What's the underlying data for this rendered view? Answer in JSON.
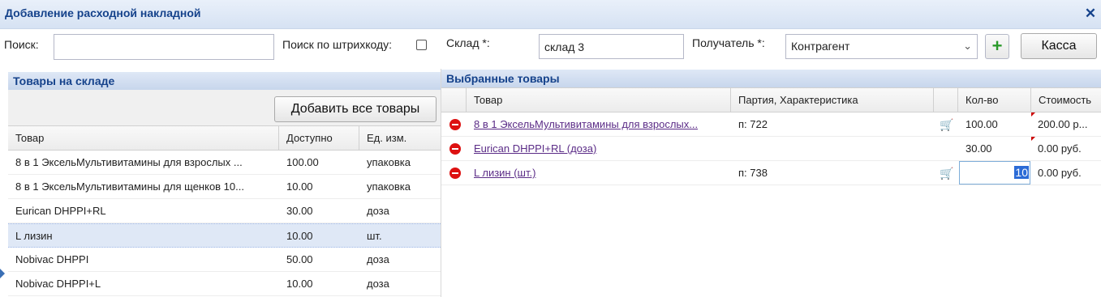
{
  "window": {
    "title": "Добавление расходной накладной"
  },
  "search": {
    "label": "Поиск:",
    "value": "",
    "barcode_label": "Поиск по штрихкоду:",
    "barcode_checked": false
  },
  "warehouse": {
    "label": "Склад *:",
    "value": "склад 3"
  },
  "recipient": {
    "label": "Получатель *:",
    "value": "Контрагент"
  },
  "cashier_button": "Касса",
  "stock_panel": {
    "title": "Товары на складе",
    "add_all_button": "Добавить все товары",
    "columns": [
      "Товар",
      "Доступно",
      "Ед. изм."
    ],
    "rows": [
      {
        "name": "8 в 1 ЭксельМультивитамины для взрослых ...",
        "available": "100.00",
        "unit": "упаковка"
      },
      {
        "name": "8 в 1 ЭксельМультивитамины для щенков 10...",
        "available": "10.00",
        "unit": "упаковка"
      },
      {
        "name": "Eurican DHPPI+RL",
        "available": "30.00",
        "unit": "доза"
      },
      {
        "name": "L лизин",
        "available": "10.00",
        "unit": "шт."
      },
      {
        "name": "Nobivac DHPPI",
        "available": "50.00",
        "unit": "доза"
      },
      {
        "name": "Nobivac DHPPI+L",
        "available": "10.00",
        "unit": "доза"
      }
    ],
    "selected_row": 3
  },
  "selected_panel": {
    "title": "Выбранные товары",
    "columns": [
      "Товар",
      "Партия, Характеристика",
      "Кол-во",
      "Стоимость"
    ],
    "rows": [
      {
        "name": "8 в 1 ЭксельМультивитамины для взрослых...",
        "batch": "п: 722",
        "cart": true,
        "qty": "100.00",
        "cost": "200.00 р..."
      },
      {
        "name": "Eurican DHPPI+RL (доза)",
        "batch": "",
        "cart": false,
        "qty": "30.00",
        "cost": "0.00 руб."
      },
      {
        "name": "L лизин (шт.)",
        "batch": "п: 738",
        "cart": true,
        "qty": "10",
        "cost": "0.00 руб.",
        "editing": true
      }
    ]
  },
  "icons": {
    "close": "close-icon",
    "add": "plus-icon",
    "remove": "remove-icon",
    "cart": "cart-icon",
    "dropdown": "chevron-down-icon"
  },
  "colors": {
    "header_text": "#15428b",
    "remove": "#dd1111",
    "add": "#2a9a2a",
    "link": "#5b2c87"
  }
}
